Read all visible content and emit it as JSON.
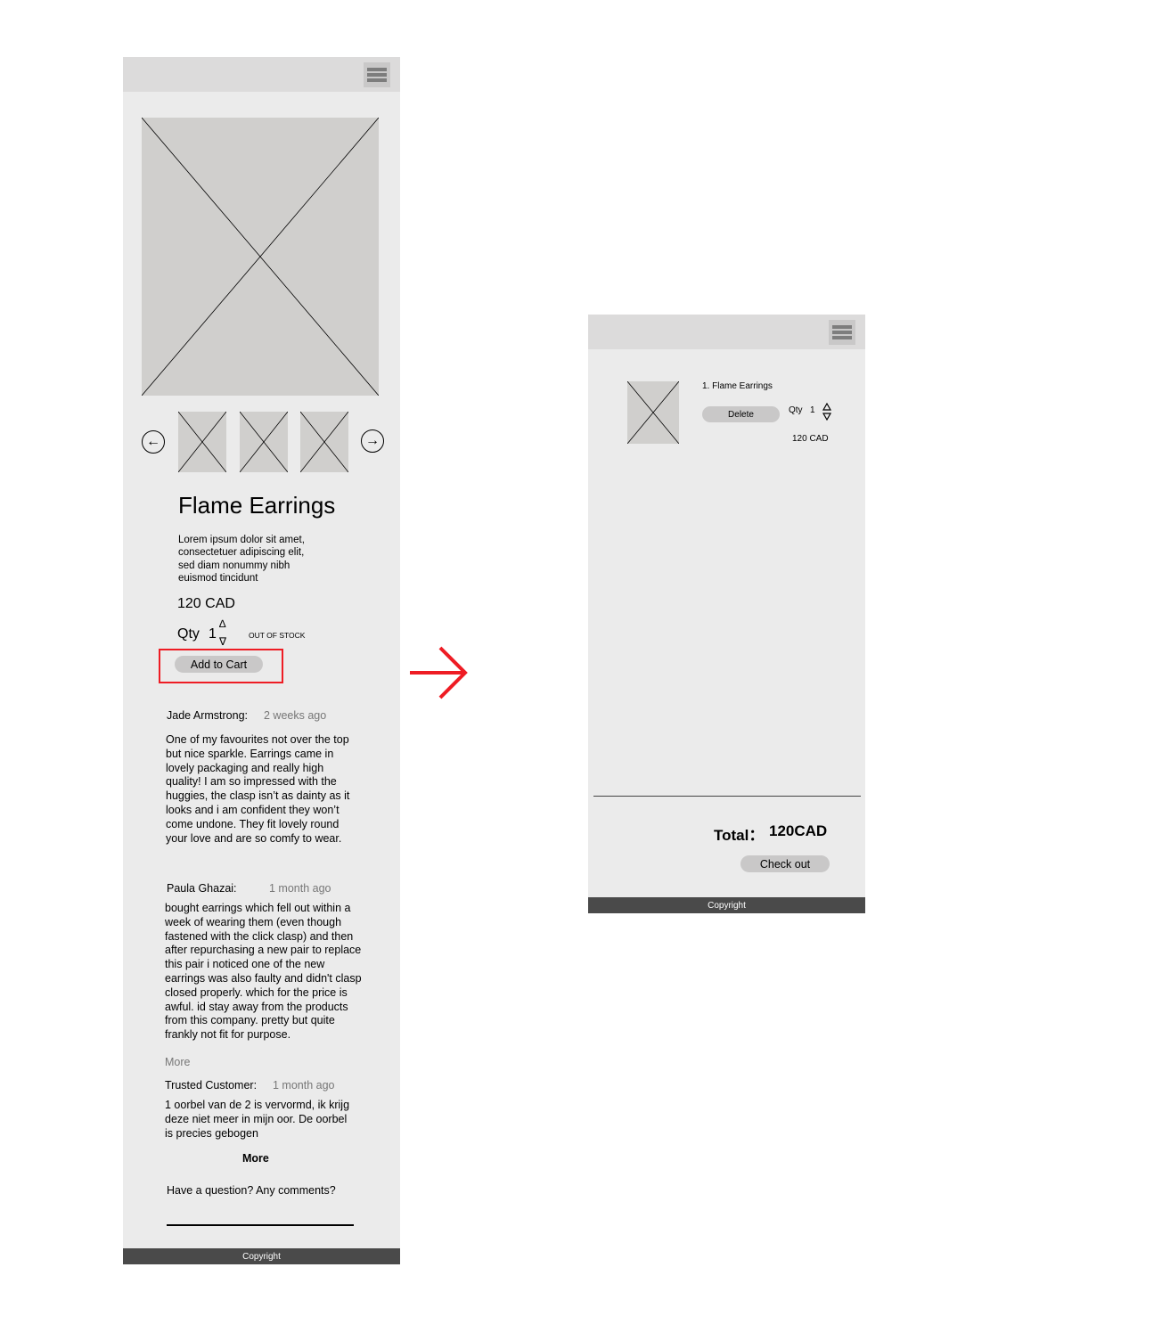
{
  "product_screen": {
    "title": "Flame Earrings",
    "description": "Lorem ipsum dolor sit amet, consectetuer adipiscing elit, sed diam nonummy nibh euismod tincidunt",
    "price": "120 CAD",
    "qty_label": "Qty",
    "qty_value": "1",
    "qty_up": "∆",
    "qty_down": "∇",
    "stock_status": "OUT OF STOCK",
    "add_to_cart_label": "Add to Cart",
    "reviews": [
      {
        "author": "Jade Armstrong:",
        "time": "2 weeks ago",
        "text": "One of my favourites not over the top but nice sparkle. Earrings came in lovely packaging and really high quality! I am so impressed with the huggies, the clasp isn’t as dainty as it looks and i am confident they won’t come undone. They fit lovely round your love and are so comfy to wear."
      },
      {
        "author": "Paula Ghazai:",
        "time": "1 month ago",
        "text": "bought earrings which fell out within a week of wearing them (even though fastened with the click clasp) and then after repurchasing a new pair to replace this pair i noticed one of the new earrings was also faulty and didn't clasp closed properly. which for the price is awful. id stay away from the products from this company. pretty but quite frankly not fit for purpose.",
        "more_label": "More"
      },
      {
        "author": "Trusted Customer:",
        "time": "1 month ago",
        "text": "1 oorbel van de 2 is vervormd, ik krijg deze niet meer in mijn oor. De oorbel is precies gebogen"
      }
    ],
    "more_reviews_label": "More",
    "question_prompt": "Have a question? Any comments?",
    "footer": "Copyright"
  },
  "cart_screen": {
    "item_name": "1. Flame Earrings",
    "delete_label": "Delete",
    "qty_label": "Qty",
    "qty_value": "1",
    "item_price": "120 CAD",
    "total_label": "Total：",
    "total_value": "120CAD",
    "checkout_label": "Check out",
    "footer": "Copyright"
  },
  "annotation": {
    "highlight_color": "#ee1c24",
    "arrow_color": "#ee1c24"
  }
}
